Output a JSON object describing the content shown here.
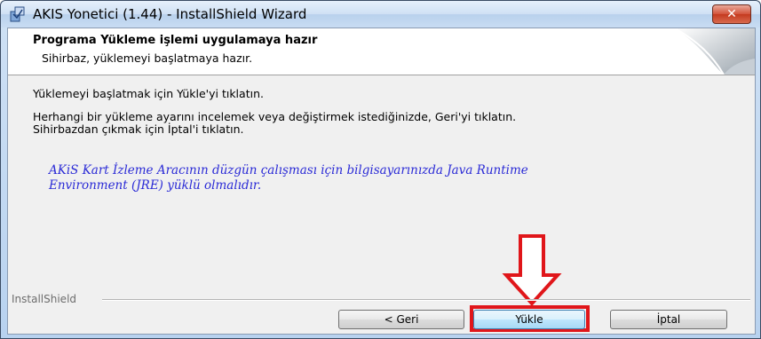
{
  "window": {
    "title": "AKIS Yonetici (1.44) - InstallShield Wizard",
    "close_label": "✕"
  },
  "header": {
    "title": "Programa Yükleme işlemi uygulamaya hazır",
    "subtitle": "Sihirbaz, yüklemeyi başlatmaya hazır."
  },
  "body": {
    "line1": "Yüklemeyi başlatmak için Yükle'yi tıklatın.",
    "line2": "Herhangi bir yükleme ayarını incelemek veya değiştirmek istediğinizde, Geri'yi tıklatın.",
    "line3": "Sihirbazdan çıkmak için İptal'i tıklatın.",
    "note_line1": "AKiS Kart İzleme Aracının düzgün çalışması için bilgisayarınızda Java Runtime",
    "note_line2": "Environment (JRE) yüklü olmalıdır."
  },
  "footer": {
    "brand": "InstallShield",
    "back_label": "< Geri",
    "install_label": "Yükle",
    "cancel_label": "İptal"
  },
  "colors": {
    "note_text": "#2a2ad6",
    "annotation_red": "#e0161a"
  },
  "icons": {
    "app": "installer-icon",
    "close": "close-icon",
    "annotation": "down-arrow-icon"
  }
}
